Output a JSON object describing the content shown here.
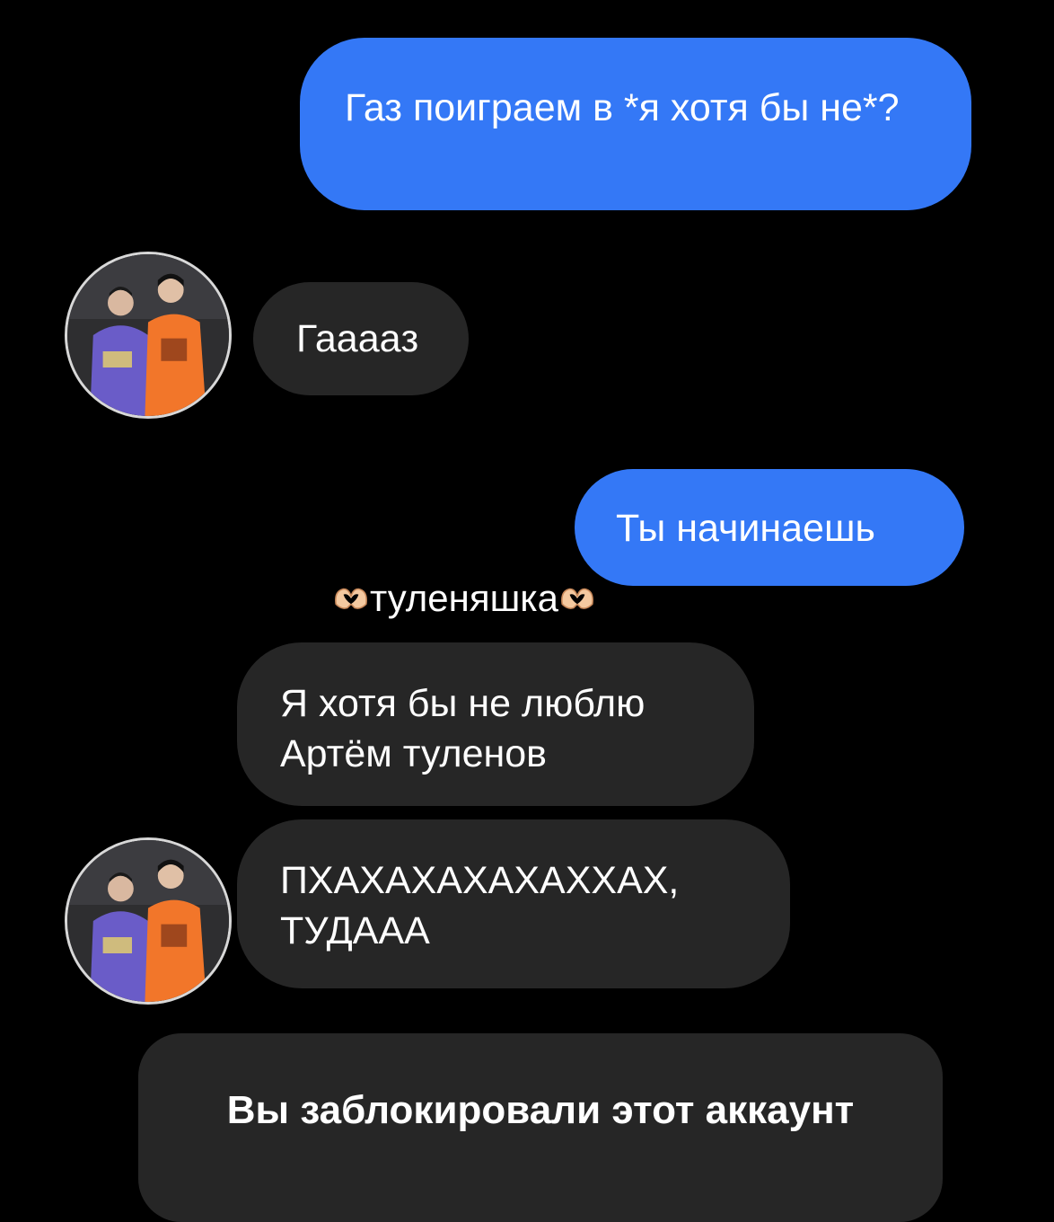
{
  "messages": [
    {
      "direction": "outgoing",
      "text": "Газ поиграем в *я хотя бы не*?"
    },
    {
      "direction": "incoming",
      "text": "Гаааaз"
    },
    {
      "direction": "outgoing",
      "text": "Ты начинаешь"
    },
    {
      "direction": "incoming",
      "text": "Я хотя бы не люблю Артём туленов"
    },
    {
      "direction": "incoming",
      "text": "ПХАХАХАХАХАХХАХ, ТУДААА"
    }
  ],
  "overlay": {
    "text": "туленяшка",
    "emoji": "heart-hands-icon"
  },
  "blocked_notice": "Вы заблокировали этот аккаунт",
  "colors": {
    "background": "#000000",
    "outgoing_bubble": "#3478f6",
    "incoming_bubble": "#262626",
    "text": "#ffffff"
  }
}
